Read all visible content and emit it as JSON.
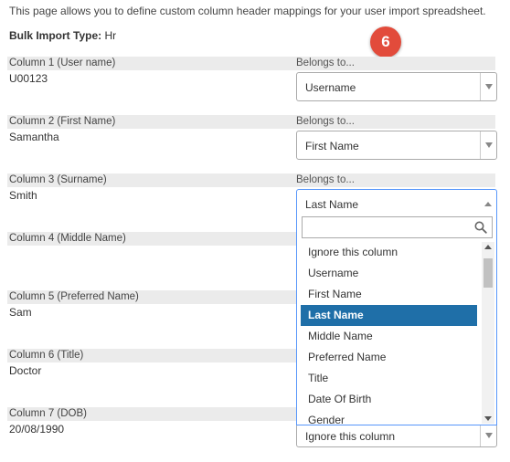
{
  "intro_text": "This page allows you to define custom column header mappings for your user import spreadsheet.",
  "bulk_import": {
    "label": "Bulk Import Type:",
    "value": "Hr"
  },
  "step_badge": "6",
  "belongs_label": "Belongs to...",
  "columns": [
    {
      "label": "Column 1 (User name)",
      "value": "U00123",
      "mapping": "Username"
    },
    {
      "label": "Column 2 (First Name)",
      "value": "Samantha",
      "mapping": "First Name"
    },
    {
      "label": "Column 3 (Surname)",
      "value": "Smith",
      "mapping": "Last Name"
    },
    {
      "label": "Column 4 (Middle Name)",
      "value": "",
      "mapping": ""
    },
    {
      "label": "Column 5 (Preferred Name)",
      "value": "Sam",
      "mapping": ""
    },
    {
      "label": "Column 6 (Title)",
      "value": "Doctor",
      "mapping": ""
    },
    {
      "label": "Column 7 (DOB)",
      "value": "20/08/1990",
      "mapping": "Ignore this column"
    }
  ],
  "dropdown": {
    "search_value": "",
    "selected": "Last Name",
    "options": [
      "Ignore this column",
      "Username",
      "First Name",
      "Last Name",
      "Middle Name",
      "Preferred Name",
      "Title",
      "Date Of Birth",
      "Gender"
    ],
    "scroll_position_fraction": 0.0
  },
  "colors": {
    "accent": "#1f6fa8",
    "badge": "#e24b3b",
    "focus_border": "#5897fb",
    "row_header_bg": "#ebebeb"
  }
}
